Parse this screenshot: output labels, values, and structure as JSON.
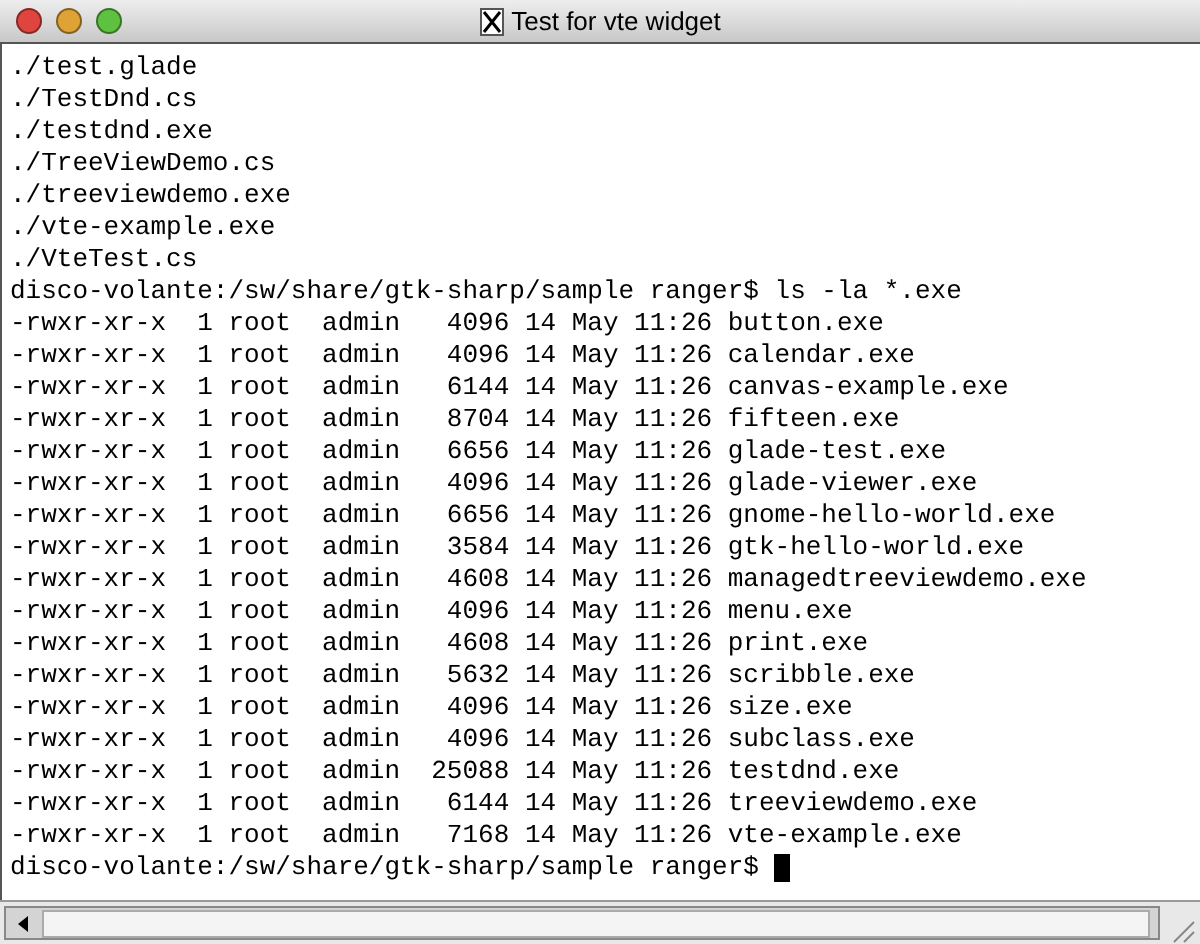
{
  "window": {
    "title": "Test for vte widget"
  },
  "terminal": {
    "lines": [
      "./test.glade",
      "./TestDnd.cs",
      "./testdnd.exe",
      "./TreeViewDemo.cs",
      "./treeviewdemo.exe",
      "./vte-example.exe",
      "./VteTest.cs",
      "disco-volante:/sw/share/gtk-sharp/sample ranger$ ls -la *.exe",
      "-rwxr-xr-x  1 root  admin   4096 14 May 11:26 button.exe",
      "-rwxr-xr-x  1 root  admin   4096 14 May 11:26 calendar.exe",
      "-rwxr-xr-x  1 root  admin   6144 14 May 11:26 canvas-example.exe",
      "-rwxr-xr-x  1 root  admin   8704 14 May 11:26 fifteen.exe",
      "-rwxr-xr-x  1 root  admin   6656 14 May 11:26 glade-test.exe",
      "-rwxr-xr-x  1 root  admin   4096 14 May 11:26 glade-viewer.exe",
      "-rwxr-xr-x  1 root  admin   6656 14 May 11:26 gnome-hello-world.exe",
      "-rwxr-xr-x  1 root  admin   3584 14 May 11:26 gtk-hello-world.exe",
      "-rwxr-xr-x  1 root  admin   4608 14 May 11:26 managedtreeviewdemo.exe",
      "-rwxr-xr-x  1 root  admin   4096 14 May 11:26 menu.exe",
      "-rwxr-xr-x  1 root  admin   4608 14 May 11:26 print.exe",
      "-rwxr-xr-x  1 root  admin   5632 14 May 11:26 scribble.exe",
      "-rwxr-xr-x  1 root  admin   4096 14 May 11:26 size.exe",
      "-rwxr-xr-x  1 root  admin   4096 14 May 11:26 subclass.exe",
      "-rwxr-xr-x  1 root  admin  25088 14 May 11:26 testdnd.exe",
      "-rwxr-xr-x  1 root  admin   6144 14 May 11:26 treeviewdemo.exe",
      "-rwxr-xr-x  1 root  admin   7168 14 May 11:26 vte-example.exe"
    ],
    "prompt": "disco-volante:/sw/share/gtk-sharp/sample ranger$"
  }
}
